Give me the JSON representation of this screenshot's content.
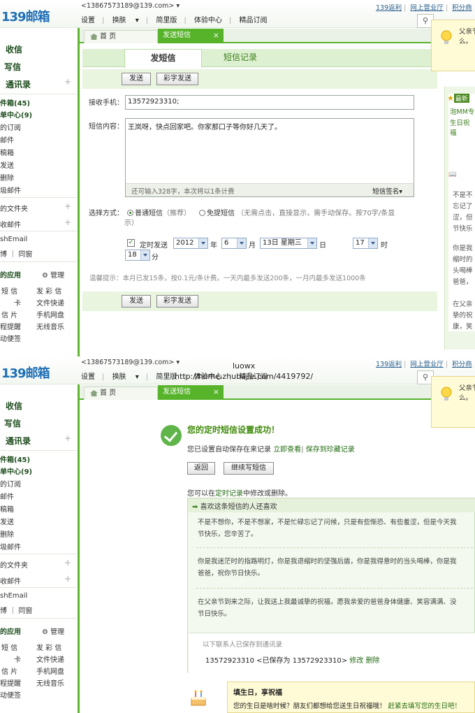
{
  "account": "<13867573189@139.com>",
  "logo": "139邮箱",
  "top_menu": [
    "设置",
    "换肤",
    "简里版",
    "体验中心",
    "精品订阅"
  ],
  "top_links": [
    "139返利",
    "网上营业厅",
    "积分商"
  ],
  "tip": {
    "line1": "父亲节",
    "line2": "么。"
  },
  "tabs": {
    "home": "首 页",
    "sms": "发送短信"
  },
  "sidebar": {
    "inbox": "收信",
    "compose": "写信",
    "contacts": "通讯录",
    "folders": [
      "件箱(45)",
      "单中心(9)",
      "的订阅",
      "邮件",
      "稿箱",
      "发送",
      "删除",
      "圾邮件"
    ],
    "myfolders": "的文件夹",
    "collected": "收邮件",
    "pushemail": "shEmail",
    "tong": "博 ｜ 同窗",
    "apps_title": "的应用",
    "manage": "管理",
    "apps": [
      [
        "短 信",
        "发 彩 信"
      ],
      [
        "卡",
        "文件快递"
      ],
      [
        "信 片",
        "手机网盘"
      ],
      [
        "程提醒",
        "无线音乐"
      ],
      [
        "动便签",
        ""
      ]
    ]
  },
  "sms_form": {
    "tab_send": "发短信",
    "tab_records": "短信记录",
    "btn_send": "发送",
    "btn_color": "彩字发送",
    "receiver_label": "接收手机：",
    "receiver_value": "13572923310;",
    "content_label": "短信内容：",
    "content_value": "王岚呀，快点回家吧。你家那口子等你好几天了。",
    "counter_text": "还可输入328字，本次将以1条计费",
    "signature": "短信签名",
    "mode_label": "选择方式：",
    "mode_normal": "普通短信",
    "mode_normal_note": "（推荐）",
    "mode_flash": "免提短信",
    "mode_flash_note": "（无需点击，直接显示，需手动保存。按70字/条显",
    "mode_flash_note2": "示）",
    "timed_label": "定时发送",
    "year": "2012",
    "year_unit": "年",
    "month": "6",
    "month_unit": "月",
    "day": "13日 星期三",
    "day_unit": "日",
    "hour": "17",
    "hour_unit": "时",
    "minute": "18",
    "minute_unit": "分",
    "hint": "温馨提示：本月已发15条，按0.1元/条计费。一天内最多发送200条，一月内最多发送1000条"
  },
  "right_panel": {
    "latest": "最新",
    "lines": [
      "泡MM专",
      "生日祝福"
    ],
    "blurbs": [
      "不是不",
      "忘记了",
      "涩，但",
      "节快乐",
      "你是我",
      "缩时的",
      "头喝棒",
      "爸爸，",
      "在父亲",
      "挚的祝",
      "康，笑"
    ]
  },
  "watermark": {
    "name": "luowx",
    "url": "http://home.zhubajie.com/4419792/"
  },
  "success": {
    "title": "您的定时短信设置成功！",
    "desc": "您已设置自动保存在来记录",
    "view": "立即查看",
    "save_link": "保存到珍藏记录",
    "btn_back": "返回",
    "btn_continue": "继续写短信",
    "modify_pre": "您可以在",
    "modify_link": "定时记录",
    "modify_post": "中修改或删除。",
    "like_header": "喜欢这条短信的人还喜欢",
    "p1a": "不是不想你，不是不想家，不是忙碌忘记了问候，只是有些惭恐、有些羞涩，但是今天我",
    "p1b": "节快乐，您辛苦了。",
    "p2a": "你是我迷茫时的指路明灯，你是我退缩时的坚强后盾，你是我得意时的当头喝棒，你是我",
    "p2b": "爸爸，祝你节日快乐。",
    "p3a": "在父亲节到来之际，让我送上我最诚挚的祝福，愿我亲爱的爸爸身体健康、笑容满满、没",
    "p3b": "节日快乐。",
    "saved_label": "以下联系人已保存到通讯录",
    "saved_contact": "13572923310 <已保存为 13572923310>",
    "edit": "修改",
    "delete": "删除",
    "bday_title": "填生日，享祝福",
    "bday_text": "您的生日是啥时候？朋友们都想给您送生日祝福哦！",
    "bday_link": "赶紧去填写您的生日吧！"
  }
}
